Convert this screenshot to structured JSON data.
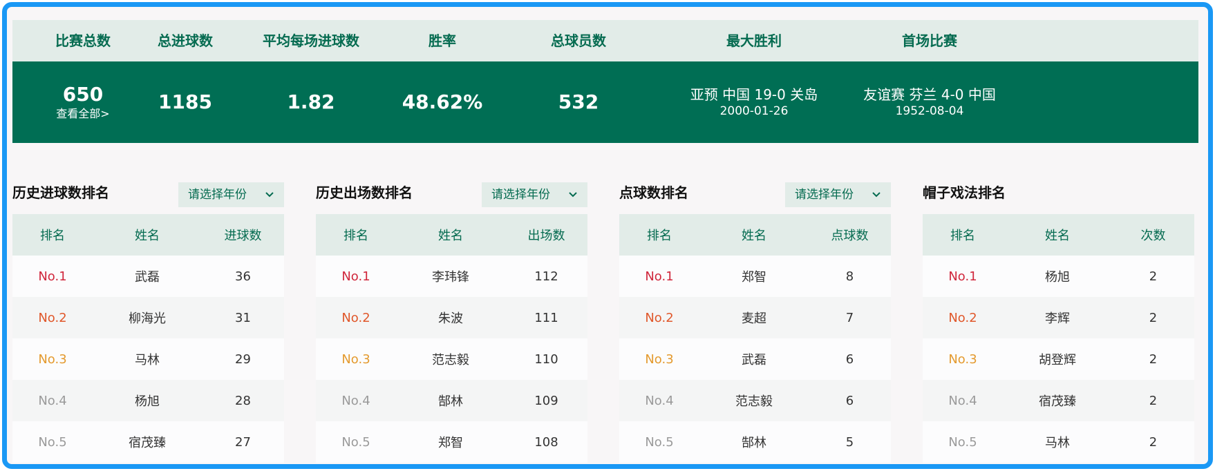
{
  "summary": {
    "labels": [
      "比赛总数",
      "总进球数",
      "平均每场进球数",
      "胜率",
      "总球员数",
      "最大胜利",
      "首场比赛"
    ],
    "total_matches": "650",
    "view_all": "查看全部>",
    "total_goals": "1185",
    "avg_goals": "1.82",
    "win_rate": "48.62%",
    "total_players": "532",
    "biggest_win": {
      "title": "亚预 中国 19-0 关岛",
      "date": "2000-01-26"
    },
    "first_match": {
      "title": "友谊赛 芬兰 4-0 中国",
      "date": "1952-08-04"
    }
  },
  "year_select_placeholder": "请选择年份",
  "panels": [
    {
      "title": "历史进球数排名",
      "headers": [
        "排名",
        "姓名",
        "进球数"
      ],
      "rows": [
        {
          "rank": "No.1",
          "name": "武磊",
          "value": "36"
        },
        {
          "rank": "No.2",
          "name": "柳海光",
          "value": "31"
        },
        {
          "rank": "No.3",
          "name": "马林",
          "value": "29"
        },
        {
          "rank": "No.4",
          "name": "杨旭",
          "value": "28"
        },
        {
          "rank": "No.5",
          "name": "宿茂臻",
          "value": "27"
        }
      ]
    },
    {
      "title": "历史出场数排名",
      "headers": [
        "排名",
        "姓名",
        "出场数"
      ],
      "rows": [
        {
          "rank": "No.1",
          "name": "李玮锋",
          "value": "112"
        },
        {
          "rank": "No.2",
          "name": "朱波",
          "value": "111"
        },
        {
          "rank": "No.3",
          "name": "范志毅",
          "value": "110"
        },
        {
          "rank": "No.4",
          "name": "郜林",
          "value": "109"
        },
        {
          "rank": "No.5",
          "name": "郑智",
          "value": "108"
        }
      ]
    },
    {
      "title": "点球数排名",
      "headers": [
        "排名",
        "姓名",
        "点球数"
      ],
      "rows": [
        {
          "rank": "No.1",
          "name": "郑智",
          "value": "8"
        },
        {
          "rank": "No.2",
          "name": "麦超",
          "value": "7"
        },
        {
          "rank": "No.3",
          "name": "武磊",
          "value": "6"
        },
        {
          "rank": "No.4",
          "name": "范志毅",
          "value": "6"
        },
        {
          "rank": "No.5",
          "name": "郜林",
          "value": "5"
        }
      ]
    },
    {
      "title": "帽子戏法排名",
      "headers": [
        "排名",
        "姓名",
        "次数"
      ],
      "rows": [
        {
          "rank": "No.1",
          "name": "杨旭",
          "value": "2"
        },
        {
          "rank": "No.2",
          "name": "李辉",
          "value": "2"
        },
        {
          "rank": "No.3",
          "name": "胡登辉",
          "value": "2"
        },
        {
          "rank": "No.4",
          "name": "宿茂臻",
          "value": "2"
        },
        {
          "rank": "No.5",
          "name": "马林",
          "value": "2"
        }
      ]
    }
  ],
  "colors": {
    "brand_green": "#006e54",
    "header_bg": "#e2ece8",
    "frame_blue": "#1a98f5",
    "rank1": "#d0263b",
    "rank2": "#e0572a",
    "rank3": "#e49a2e",
    "rank_other": "#9a9a9a"
  }
}
